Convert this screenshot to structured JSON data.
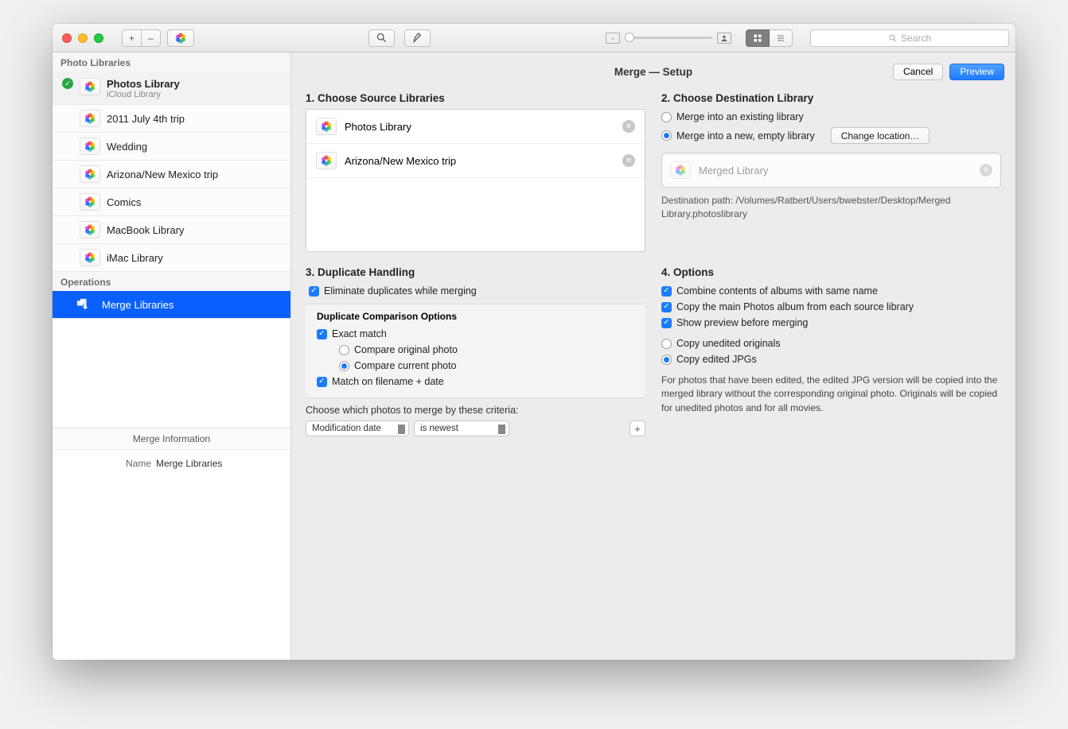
{
  "toolbar": {
    "search_placeholder": "Search"
  },
  "sidebar": {
    "section_libraries": "Photo Libraries",
    "section_operations": "Operations",
    "libraries": [
      {
        "name": "Photos Library",
        "subtitle": "iCloud Library",
        "primary": true
      },
      {
        "name": "2011 July 4th trip"
      },
      {
        "name": "Wedding"
      },
      {
        "name": "Arizona/New Mexico trip"
      },
      {
        "name": "Comics"
      },
      {
        "name": "MacBook Library"
      },
      {
        "name": "iMac Library"
      }
    ],
    "operations": [
      {
        "name": "Merge Libraries"
      }
    ],
    "info_header": "Merge Information",
    "info_label": "Name",
    "info_value": "Merge Libraries"
  },
  "detail": {
    "title": "Merge — Setup",
    "cancel_label": "Cancel",
    "preview_label": "Preview",
    "s1_title": "1. Choose Source Libraries",
    "s1_items": [
      "Photos Library",
      "Arizona/New Mexico trip"
    ],
    "s2_title": "2. Choose Destination Library",
    "s2_opt_existing": "Merge into an existing library",
    "s2_opt_new": "Merge into a new, empty library",
    "s2_change_location": "Change location…",
    "s2_dest_name": "Merged Library",
    "s2_path_label": "Destination path: ",
    "s2_path_value": "/Volumes/Ratbert/Users/bwebster/Desktop/Merged Library.photoslibrary",
    "s3_title": "3. Duplicate Handling",
    "s3_eliminate": "Eliminate duplicates while merging",
    "s3_sub_hdr": "Duplicate Comparison Options",
    "s3_exact": "Exact match",
    "s3_compare_original": "Compare original photo",
    "s3_compare_current": "Compare current photo",
    "s3_match_filename": "Match on filename + date",
    "s3_criteria_note": "Choose which photos to merge by these criteria:",
    "s3_sel_field": "Modification date",
    "s3_sel_op": "is newest",
    "s4_title": "4. Options",
    "s4_combine": "Combine contents of albums with same name",
    "s4_copy_main": "Copy the main Photos album from each source library",
    "s4_preview": "Show preview before merging",
    "s4_copy_unedited": "Copy unedited originals",
    "s4_copy_edited": "Copy edited JPGs",
    "s4_help": "For photos that have been edited, the edited JPG version will be copied into the merged library without the corresponding original photo. Originals will be copied for unedited photos and for all movies."
  }
}
